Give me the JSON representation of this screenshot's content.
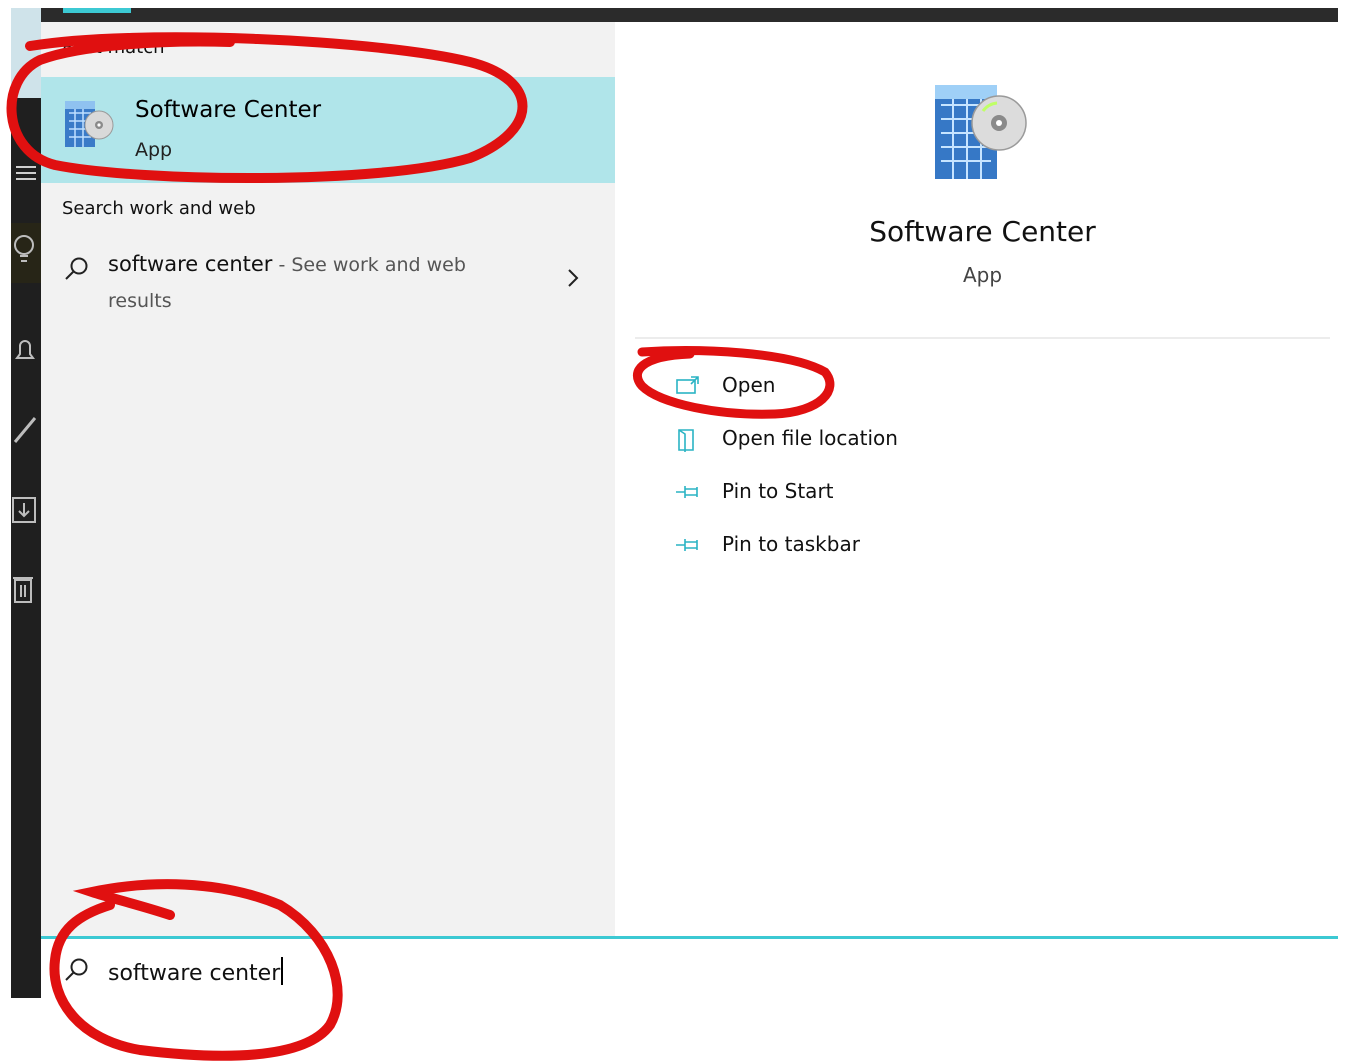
{
  "best_match": {
    "header": "Best match",
    "title": "Software Center",
    "subtitle": "App"
  },
  "search_web": {
    "header": "Search work and web",
    "query": "software center",
    "hint_line1": " - See work and web",
    "hint_line2": "results"
  },
  "preview": {
    "title": "Software Center",
    "subtitle": "App",
    "actions": [
      {
        "label": "Open",
        "icon": "open-icon"
      },
      {
        "label": "Open file location",
        "icon": "file-location-icon"
      },
      {
        "label": "Pin to Start",
        "icon": "pin-icon"
      },
      {
        "label": "Pin to taskbar",
        "icon": "pin-icon"
      }
    ]
  },
  "search": {
    "value": "software center"
  },
  "colors": {
    "accent": "#3cc9d3",
    "selection": "#b0e5ea",
    "annotation": "#e01010"
  },
  "taskbar_icons": [
    "hamburger-menu-icon",
    "lightbulb-icon",
    "bell-icon",
    "pen-icon",
    "download-icon",
    "trash-icon"
  ]
}
